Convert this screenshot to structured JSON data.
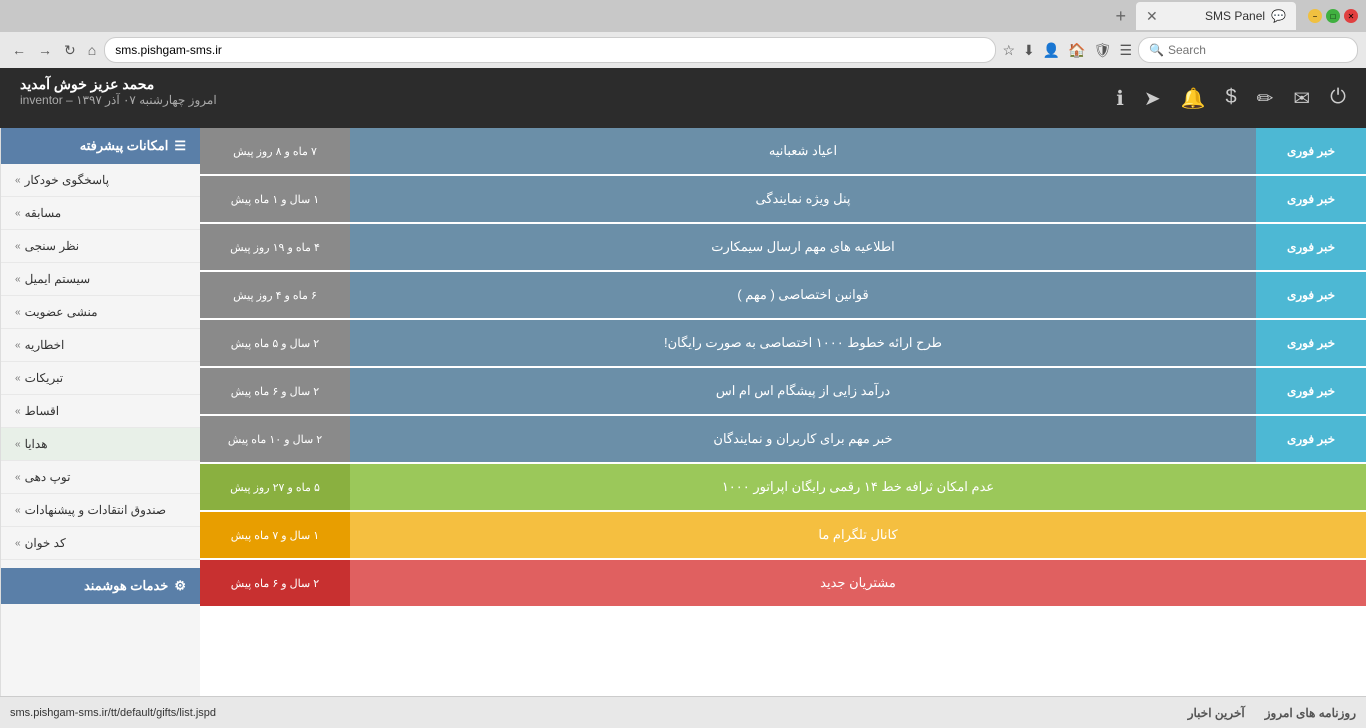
{
  "browser": {
    "tab_title": "SMS Panel",
    "address": "sms.pishgam-sms.ir",
    "search_placeholder": "Search",
    "window_min": "−",
    "window_max": "□",
    "window_close": "✕"
  },
  "topnav": {
    "user_name": "محمد عزیز خوش آمدید",
    "user_role": "inventor",
    "user_date": "امروز چهارشنبه ۰۷ آذر ۱۳۹۷"
  },
  "sidebar": {
    "header": "امکانات پیشرفته",
    "items": [
      {
        "label": "پاسخگوی خودکار",
        "id": "auto-reply"
      },
      {
        "label": "مسابقه",
        "id": "competition"
      },
      {
        "label": "نظر سنجی",
        "id": "survey"
      },
      {
        "label": "سیستم ایمیل",
        "id": "email-system"
      },
      {
        "label": "منشی عضویت",
        "id": "membership-secretary"
      },
      {
        "label": "اخطاریه",
        "id": "warning"
      },
      {
        "label": "تبریکات",
        "id": "congratulations"
      },
      {
        "label": "اقساط",
        "id": "installments"
      },
      {
        "label": "هدایا",
        "id": "gifts",
        "active": true
      },
      {
        "label": "توپ دهی",
        "id": "rating"
      },
      {
        "label": "صندوق انتقادات و پیشنهادات",
        "id": "suggestions"
      },
      {
        "label": "کد خوان",
        "id": "code-reader"
      }
    ],
    "services_header": "خدمات هوشمند"
  },
  "news": [
    {
      "tag": "خبر فوری",
      "title": "اعیاد شعبانیه",
      "date": "۷ ماه و ۸ روز پیش",
      "type": "blue"
    },
    {
      "tag": "خبر فوری",
      "title": "پنل ویژه نمایندگی",
      "date": "۱ سال و ۱ ماه پیش",
      "type": "blue"
    },
    {
      "tag": "خبر فوری",
      "title": "اطلاعیه های مهم ارسال سیمکارت",
      "date": "۴ ماه و ۱۹ روز پیش",
      "type": "blue"
    },
    {
      "tag": "خبر فوری",
      "title": "قوانین اختصاصی ( مهم )",
      "date": "۶ ماه و ۴ روز پیش",
      "type": "blue"
    },
    {
      "tag": "خبر فوری",
      "title": "طرح ارائه خطوط ۱۰۰۰ اختصاصی به صورت رایگان!",
      "date": "۲ سال و ۵ ماه پیش",
      "type": "blue"
    },
    {
      "tag": "خبر فوری",
      "title": "درآمد زایی از پیشگام اس ام اس",
      "date": "۲ سال و ۶ ماه پیش",
      "type": "blue"
    },
    {
      "tag": "خبر فوری",
      "title": "خبر مهم برای کاربران و نمایندگان",
      "date": "۲ سال و ۱۰ ماه پیش",
      "type": "blue"
    },
    {
      "tag": "",
      "title": "عدم امکان ثرافه خط ۱۴ رقمی رایگان اپراتور ۱۰۰۰",
      "date": "۵ ماه و ۲۷ روز پیش",
      "type": "green"
    },
    {
      "tag": "",
      "title": "کانال تلگرام ما",
      "date": "۱ سال و ۷ ماه پیش",
      "type": "yellow"
    },
    {
      "tag": "",
      "title": "مشتریان جدید",
      "date": "۲ سال و ۶ ماه پیش",
      "type": "red"
    }
  ],
  "bottom": {
    "url": "sms.pishgam-sms.ir/tt/default/gifts/list.jspd",
    "section1": "روزنامه های امروز",
    "section2": "آخرین اخبار"
  }
}
